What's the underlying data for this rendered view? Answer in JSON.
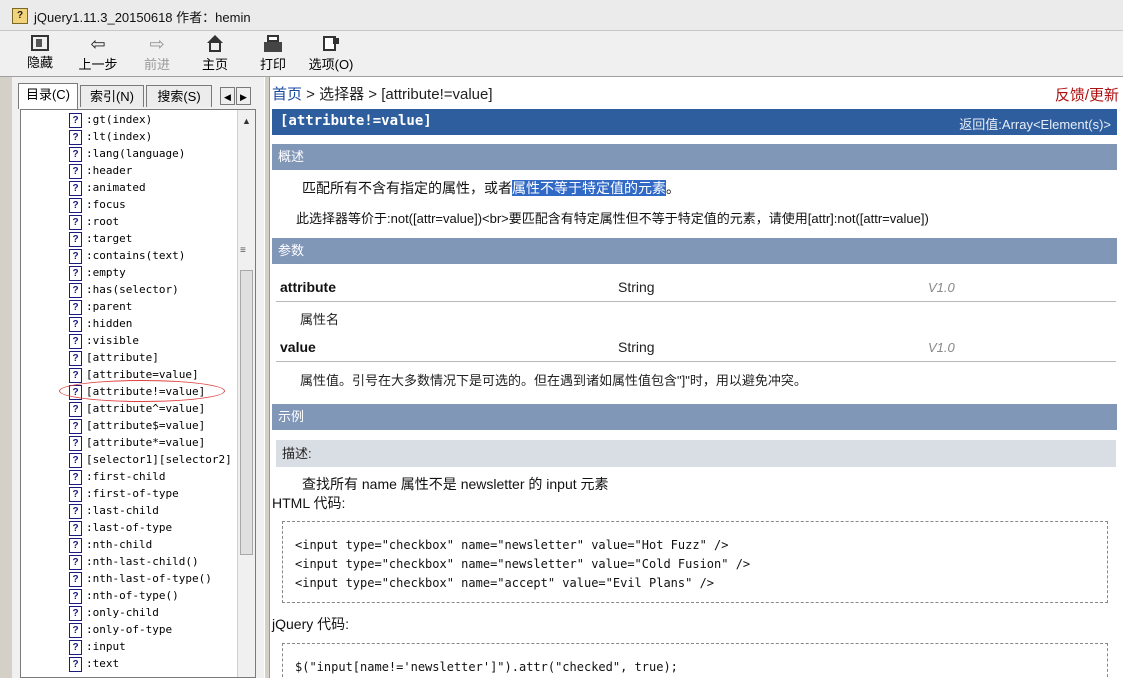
{
  "window": {
    "title": "jQuery1.11.3_20150618 作者：hemin"
  },
  "toolbar": [
    {
      "name": "hide-button",
      "label": "隐藏",
      "icon": "hide-icon",
      "enabled": true
    },
    {
      "name": "back-button",
      "label": "上一步",
      "icon": "back-arrow-icon",
      "enabled": true
    },
    {
      "name": "forward-button",
      "label": "前进",
      "icon": "forward-arrow-icon",
      "enabled": false
    },
    {
      "name": "home-button",
      "label": "主页",
      "icon": "home-icon",
      "enabled": true
    },
    {
      "name": "print-button",
      "label": "打印",
      "icon": "print-icon",
      "enabled": true
    },
    {
      "name": "options-button",
      "label": "选项(O)",
      "icon": "options-icon",
      "enabled": true
    }
  ],
  "sidebar": {
    "tabs": [
      "目录(C)",
      "索引(N)",
      "搜索(S)"
    ],
    "active_tab": 0,
    "tree": [
      ":gt(index)",
      ":lt(index)",
      ":lang(language)",
      ":header",
      ":animated",
      ":focus",
      ":root",
      ":target",
      ":contains(text)",
      ":empty",
      ":has(selector)",
      ":parent",
      ":hidden",
      ":visible",
      "[attribute]",
      "[attribute=value]",
      "[attribute!=value]",
      "[attribute^=value]",
      "[attribute$=value]",
      "[attribute*=value]",
      "[selector1][selector2]",
      ":first-child",
      ":first-of-type",
      ":last-child",
      ":last-of-type",
      ":nth-child",
      ":nth-last-child()",
      ":nth-last-of-type()",
      ":nth-of-type()",
      ":only-child",
      ":only-of-type",
      ":input",
      ":text"
    ],
    "selected_index": 16
  },
  "content": {
    "breadcrumb": {
      "home": "首页",
      "rest": " > 选择器 > [attribute!=value]"
    },
    "feedback": "反馈/更新",
    "banner": {
      "title": "[attribute!=value]",
      "returns": "返回值:Array<Element(s)>"
    },
    "overview": {
      "heading": "概述",
      "line1_pre": "匹配所有不含有指定的属性，或者",
      "line1_sel": "属性不等于特定值的元素",
      "line1_post": "。",
      "line2": "此选择器等价于:not([attr=value])<br>要匹配含有特定属性但不等于特定值的元素，请使用[attr]:not([attr=value])"
    },
    "params": {
      "heading": "参数",
      "items": [
        {
          "name": "attribute",
          "type": "String",
          "version": "V1.0",
          "desc": "属性名"
        },
        {
          "name": "value",
          "type": "String",
          "version": "V1.0",
          "desc": "属性值。引号在大多数情况下是可选的。但在遇到诸如属性值包含\"]\"时，用以避免冲突。"
        }
      ]
    },
    "example": {
      "heading": "示例",
      "desc_label": "描述:",
      "desc": "查找所有 name 属性不是 newsletter 的 input 元素",
      "html_label": "HTML 代码:",
      "html_code": [
        "<input type=\"checkbox\" name=\"newsletter\" value=\"Hot Fuzz\" />",
        "<input type=\"checkbox\" name=\"newsletter\" value=\"Cold Fusion\" />",
        "<input type=\"checkbox\" name=\"accept\" value=\"Evil Plans\" />"
      ],
      "js_label": "jQuery 代码:",
      "js_code": [
        "$(\"input[name!='newsletter']\").attr(\"checked\", true);"
      ]
    }
  },
  "colors": {
    "banner": "#2e5e9e",
    "section": "#8197b8",
    "selection": "#3169c6",
    "feedback": "#b01010",
    "annotation_ring": "#e04040"
  }
}
